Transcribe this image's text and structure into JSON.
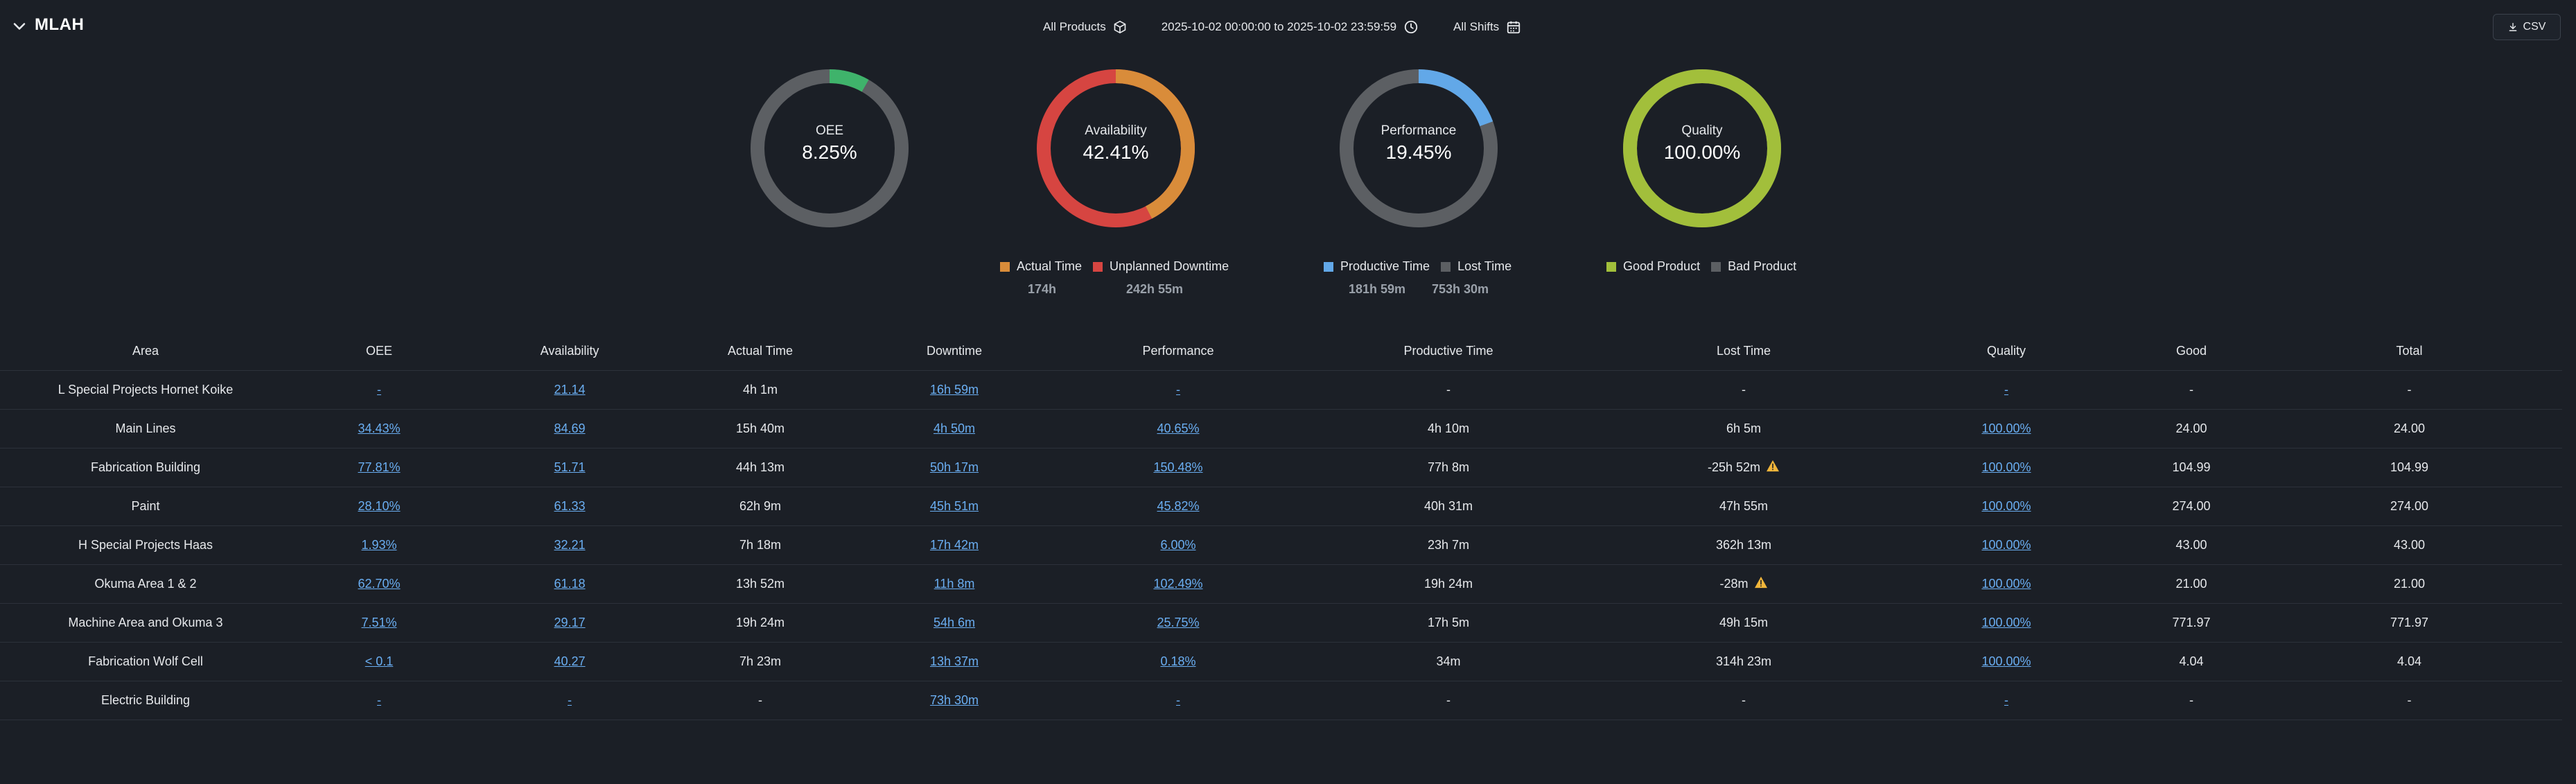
{
  "header": {
    "title": "MLAH",
    "products_label": "All Products",
    "date_range": "2025-10-02 00:00:00 to 2025-10-02 23:59:59",
    "shifts_label": "All Shifts",
    "csv_label": "CSV"
  },
  "colors": {
    "background": "#1b1f26",
    "oee_green": "#3fb36b",
    "actual_time": "#d98c3a",
    "unplanned_downtime": "#d64541",
    "productive_time": "#62a8e8",
    "lost_time": "#5c5f63",
    "good_product": "#a2bf3b",
    "bad_product": "#5c5f63",
    "link": "#6aaef2"
  },
  "gauges": [
    {
      "label": "OEE",
      "value": "8.25%",
      "fraction": 0.0825,
      "color": "#3fb36b",
      "track": "#5c5f63"
    },
    {
      "label": "Availability",
      "value": "42.41%",
      "fraction": 0.4241,
      "color": "#d98c3a",
      "track": "#d64541"
    },
    {
      "label": "Performance",
      "value": "19.45%",
      "fraction": 0.1945,
      "color": "#62a8e8",
      "track": "#5c5f63"
    },
    {
      "label": "Quality",
      "value": "100.00%",
      "fraction": 1.0,
      "color": "#a2bf3b",
      "track": "#5c5f63"
    }
  ],
  "legends": {
    "availability": {
      "items": [
        {
          "label": "Actual Time",
          "color": "#d98c3a",
          "value": "174h"
        },
        {
          "label": "Unplanned Downtime",
          "color": "#d64541",
          "value": "242h 55m"
        }
      ]
    },
    "performance": {
      "items": [
        {
          "label": "Productive Time",
          "color": "#62a8e8",
          "value": "181h 59m"
        },
        {
          "label": "Lost Time",
          "color": "#5c5f63",
          "value": "753h 30m"
        }
      ]
    },
    "quality": {
      "items": [
        {
          "label": "Good Product",
          "color": "#a2bf3b"
        },
        {
          "label": "Bad Product",
          "color": "#5c5f63"
        }
      ]
    }
  },
  "table": {
    "columns": [
      "Area",
      "OEE",
      "Availability",
      "Actual Time",
      "Downtime",
      "Performance",
      "Productive Time",
      "Lost Time",
      "Quality",
      "Good",
      "Total"
    ],
    "rows": [
      [
        "L Special Projects Hornet Koike",
        "-",
        "21.14",
        "4h 1m",
        "16h 59m",
        "-",
        "-",
        "-",
        "-",
        "-",
        "-"
      ],
      [
        "Main Lines",
        "34.43%",
        "84.69",
        "15h 40m",
        "4h 50m",
        "40.65%",
        "4h 10m",
        "6h 5m",
        "100.00%",
        "24.00",
        "24.00"
      ],
      [
        "Fabrication Building",
        "77.81%",
        "51.71",
        "44h 13m",
        "50h 17m",
        "150.48%",
        "77h 8m",
        "-25h 52m",
        "100.00%",
        "104.99",
        "104.99"
      ],
      [
        "Paint",
        "28.10%",
        "61.33",
        "62h 9m",
        "45h 51m",
        "45.82%",
        "40h 31m",
        "47h 55m",
        "100.00%",
        "274.00",
        "274.00"
      ],
      [
        "H Special Projects Haas",
        "1.93%",
        "32.21",
        "7h 18m",
        "17h 42m",
        "6.00%",
        "23h 7m",
        "362h 13m",
        "100.00%",
        "43.00",
        "43.00"
      ],
      [
        "Okuma Area 1 & 2",
        "62.70%",
        "61.18",
        "13h 52m",
        "11h 8m",
        "102.49%",
        "19h 24m",
        "-28m",
        "100.00%",
        "21.00",
        "21.00"
      ],
      [
        "Machine Area and Okuma 3",
        "7.51%",
        "29.17",
        "19h 24m",
        "54h 6m",
        "25.75%",
        "17h 5m",
        "49h 15m",
        "100.00%",
        "771.97",
        "771.97"
      ],
      [
        "Fabrication Wolf Cell",
        "< 0.1",
        "40.27",
        "7h 23m",
        "13h 37m",
        "0.18%",
        "34m",
        "314h 23m",
        "100.00%",
        "4.04",
        "4.04"
      ],
      [
        "Electric Building",
        "-",
        "-",
        "-",
        "73h 30m",
        "-",
        "-",
        "-",
        "-",
        "-",
        "-"
      ]
    ]
  }
}
